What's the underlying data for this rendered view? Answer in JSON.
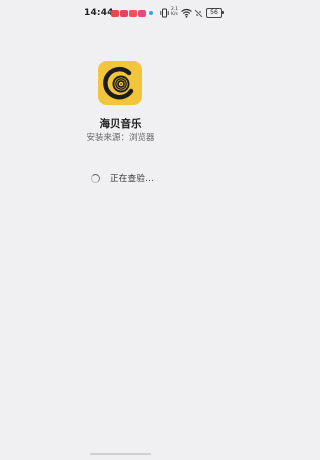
{
  "status_bar": {
    "time": "14:44",
    "notification_icons": [
      "red-app-icon",
      "red-app-icon",
      "red-app-icon",
      "pink-app-icon",
      "blue-dot-icon"
    ],
    "network_speed": "2.1 K/s",
    "battery": "56"
  },
  "app": {
    "name": "海贝音乐",
    "install_source": "安装来源：浏览器",
    "icon": "vinyl-record-icon",
    "icon_color": "#f2c53d"
  },
  "status": {
    "checking_text": "正在查验..."
  },
  "colors": {
    "background": "#f0f0f2",
    "accent": "#f2c53d"
  }
}
